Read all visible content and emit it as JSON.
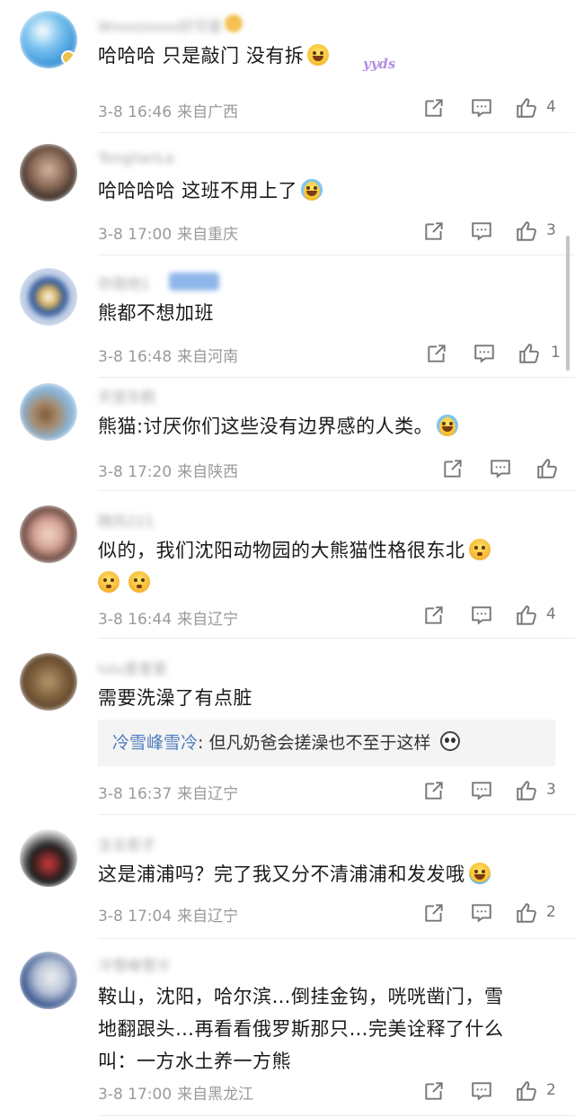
{
  "comments": [
    {
      "username": "Wxxxzxxxx好可爱",
      "text": "哈哈哈 只是敲门 没有拆",
      "emoji": "grin-emoji",
      "decoration": "yyds",
      "date": "3-8 16:46",
      "location": "来自广西",
      "likes": "4",
      "avatar_colors": [
        "#3b94d8",
        "#ffffff",
        "#f0c14a"
      ]
    },
    {
      "username": "TonglianLa",
      "text": "哈哈哈哈  这班不用上了",
      "emoji": "tears-of-joy-emoji",
      "date": "3-8 17:00",
      "location": "来自重庆",
      "likes": "3",
      "avatar_colors": [
        "#3a2a25",
        "#c9a58c",
        "#1d1512"
      ]
    },
    {
      "username": "你我他1",
      "text": "熊都不想加班",
      "date": "3-8 16:48",
      "location": "来自河南",
      "likes": "1",
      "avatar_colors": [
        "#1f4f9c",
        "#ffffff",
        "#d8b15a"
      ]
    },
    {
      "username": "天堂灰鹤",
      "text": "熊猫:讨厌你们这些没有边界感的人类。",
      "emoji": "tears-of-joy-emoji",
      "date": "3-8 17:20",
      "location": "来自陕西",
      "likes": "",
      "avatar_colors": [
        "#87b4d9",
        "#7a5a3a",
        "#c8d7e4"
      ]
    },
    {
      "username": "随风221",
      "text_lines": [
        "似的，我们沈阳动物园的大熊猫性格很东北"
      ],
      "emoji": "shy-emoji",
      "date": "3-8 16:44",
      "location": "来自辽宁",
      "likes": "4",
      "avatar_colors": [
        "#5a3a33",
        "#e6c2b2",
        "#2b1d1a"
      ]
    },
    {
      "username": "lulu爱爱爱",
      "text": "需要洗澡了有点脏",
      "reply_user": "冷雪峰雪冷",
      "reply_text": ": 但凡奶爸会搓澡也不至于这样",
      "date": "3-8 16:37",
      "location": "来自辽宁",
      "likes": "3",
      "avatar_colors": [
        "#7a5b3a",
        "#b49a6c",
        "#3c2a1c"
      ]
    },
    {
      "username": "言言若子",
      "text": "这是浦浦吗？完了我又分不清浦浦和发发哦",
      "emoji": "cry-emoji",
      "date": "3-8 17:04",
      "location": "来自辽宁",
      "likes": "2",
      "avatar_colors": [
        "#e9e9e9",
        "#1a1a1a",
        "#d53a3a"
      ]
    },
    {
      "username": "冷雪峰雪冷",
      "text_lines": [
        "鞍山，沈阳，哈尔滨…倒挂金钩，咣咣凿门，雪",
        "地翻跟头…再看看俄罗斯那只…完美诠释了什么",
        "叫：一方水土养一方熊"
      ],
      "date": "3-8 17:00",
      "location": "来自黑龙江",
      "likes": "2",
      "avatar_colors": [
        "#2b4a86",
        "#f0f0f0",
        "#b9c4d8"
      ]
    }
  ],
  "icons": {
    "share": "share-icon",
    "comment": "comment-icon",
    "like": "thumbs-up-icon"
  },
  "colors": {
    "reply_user": "#4d7cbf",
    "meta": "#9a9a9a",
    "yyds_tag": "#b58ce6"
  }
}
